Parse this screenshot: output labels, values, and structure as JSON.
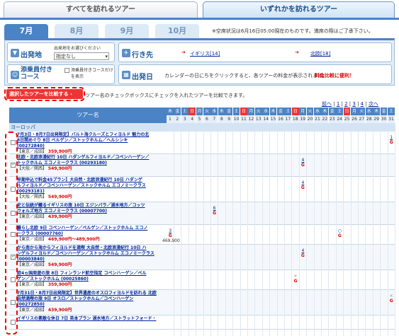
{
  "top_tabs": [
    "すべてを訪れるツアー",
    "いずれかを訪れるツアー"
  ],
  "month_tabs": [
    "7月",
    "8月",
    "9月",
    "10月"
  ],
  "note": "※空席状況は6月16日05:00現在のものです。満席の際はご了承下さい。",
  "departure": {
    "label": "出発地",
    "hint": "出発地をお選びください",
    "value": "指定なし"
  },
  "destination": {
    "label": "行き先",
    "items": [
      "イギリス[14]",
      "北欧[18]"
    ]
  },
  "escort": {
    "label": "添乗員付き\nコース",
    "checkbox": "添乗員付きコースだけを表示"
  },
  "depdate": {
    "label": "出発日",
    "text": "カレンダーの日にちをクリックすると、各ツアーの料金が表示されます。",
    "text_red": "料金比較に便利！"
  },
  "compare": {
    "button": "選択したツアーを比較する ›",
    "text": "ツアー名のチェックボックスにチェックを入れたツアーを比較できます。"
  },
  "pager": {
    "prev": "前へ",
    "pages": [
      "1",
      "2",
      "3",
      "4"
    ],
    "next": "次へ"
  },
  "header": {
    "tour": "ツアー名"
  },
  "days": {
    "weekdays": [
      "木",
      "金",
      "土",
      "日",
      "月",
      "火",
      "水",
      "木",
      "金",
      "土",
      "日",
      "月",
      "火",
      "水",
      "木",
      "金",
      "土",
      "日",
      "月",
      "火",
      "水",
      "木",
      "金",
      "土",
      "日",
      "月",
      "火",
      "水",
      "木",
      "金",
      "土"
    ],
    "numbers": [
      "1",
      "2",
      "3",
      "4",
      "5",
      "6",
      "7",
      "8",
      "9",
      "10",
      "11",
      "12",
      "13",
      "14",
      "15",
      "16",
      "17",
      "18",
      "19",
      "20",
      "21",
      "22",
      "23",
      "24",
      "25",
      "26",
      "27",
      "28",
      "29",
      "30",
      "31"
    ]
  },
  "region": "ヨーロッパ",
  "tours": [
    {
      "title": "7月3日・8月7日出発限定】バルト海クルーズとフィヨルド 魅力の北\n8日間めぐり 8日 ベルゲン／ストックホルム／ヘルシンキ\n(00272840)",
      "origin": "【東京／成田】",
      "price": "359,900円",
      "checked": false
    },
    {
      "title": "北欧・北欧浪漫紀行 10日 ハダンゲルフィヨルド／コペンハーゲン／\nトックホルム エコノミークラス (00293180)",
      "origin": "【大阪／関西】",
      "price": "549,900円",
      "checked": true
    },
    {
      "title": "早期申込で料金45プラン】大自然・北欧浪漫紀行 10日 ハダンゲ\nルフィヨルド／コペンハーゲン／ストックホルム エコノミークラス\n(00293181)",
      "origin": "【大阪／関西】",
      "price": "549,900円",
      "checked": false
    },
    {
      "title": "史と伝統が織るイギリスの旅 10日 エジンバラ／湖水地方／コッツ\nウォルズ地方 エコノミークラス (00007700)",
      "origin": "【東京／成田】",
      "price": "439,900円",
      "checked": false
    },
    {
      "title": "暮らし北欧 9日 コペンハーゲン／ベルゲン／ストックホルム エコノ\nークラス (00007760)",
      "origin": "【東京／成田】",
      "price": "469,900円〜489,900円",
      "checked": false
    },
    {
      "title": "から南から海からフィヨルドを満喫 大自然・北欧浪漫紀行 10日 ハ\nンゲルフィヨルド／コペンハーゲン／ストックホルム エコノミークラス\n(00003840)",
      "origin": "【東京／成田】",
      "price": "549,900円",
      "checked": true
    },
    {
      "title": "欧4ヵ国周遊の旅 8日 フィンランド航空指定 コペンハーゲン／ベル\nゲン／ストックホルム (00025860)",
      "origin": "【東京／成田】",
      "price": "359,900円",
      "checked": false
    },
    {
      "title": "7月31日・8月7日出発限定】世界遺産のオスロフィヨルドを訪れる 北欧\n自然満喫の旅 9日 オスロ／ストックホルム／コペンハーゲン\n(00272850)",
      "origin": "【東京／成田】",
      "price": "439,900円",
      "checked": false
    },
    {
      "title": "イギリスの素敵な休日 7日 英本プラン 湖水地方／ストラットフォード・",
      "origin": "",
      "price": "",
      "checked": false
    }
  ],
  "cells": [
    {
      "row": 0,
      "day": "31",
      "lines": [
        "1",
        "G"
      ]
    },
    {
      "row": 1,
      "day": "19",
      "lines": [
        "4",
        "G"
      ]
    },
    {
      "row": 2,
      "day": "19",
      "lines": [
        "4",
        "G"
      ]
    },
    {
      "row": 3,
      "day": "7",
      "lines": [
        "6",
        "G"
      ]
    },
    {
      "row": 4,
      "day": "1",
      "lines": [
        "3",
        "G",
        "469,900"
      ]
    },
    {
      "row": 4,
      "day": "24",
      "lines": [
        "○",
        "G"
      ]
    },
    {
      "row": 5,
      "day": "19",
      "lines": [
        "4",
        "G"
      ]
    },
    {
      "row": 6,
      "day": "18",
      "lines": [
        "×",
        "G"
      ]
    },
    {
      "row": 7,
      "day": "31",
      "lines": [
        "×",
        "G"
      ]
    }
  ],
  "colors": {
    "accent": "#4a83c6",
    "sat": "#4a83c6",
    "sun": "#e33",
    "price": "#d00"
  }
}
